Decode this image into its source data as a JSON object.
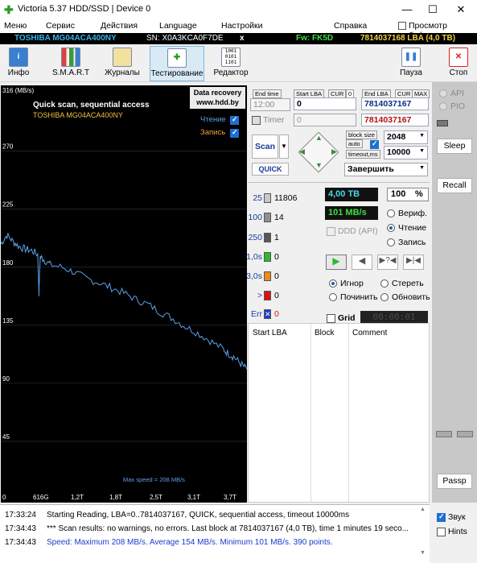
{
  "window": {
    "title": "Victoria 5.37 HDD/SSD | Device 0",
    "controls": [
      "—",
      "☐",
      "✕"
    ]
  },
  "menu": [
    "Меню",
    "Сервис",
    "Действия",
    "Language",
    "Настройки",
    "Справка"
  ],
  "menu_right": "Просмотр буфера",
  "drive": {
    "model": "TOSHIBA MG04ACA400NY",
    "serial": "SN: X0A3KCA0F7DE",
    "close": "x",
    "firmware": "Fw: FK5D",
    "lba": "7814037168 LBA (4,0 TB)"
  },
  "toolbar": [
    {
      "label": "Инфо"
    },
    {
      "label": "S.M.A.R.T"
    },
    {
      "label": "Журналы"
    },
    {
      "label": "Тестирование"
    },
    {
      "label": "Редактор"
    },
    {
      "label": "Пауза"
    },
    {
      "label": "Стоп"
    }
  ],
  "graph": {
    "ylabel": "316 (MB/s)",
    "title": "Quick scan, sequential access",
    "subtitle": "TOSHIBA MG04ACA400NY",
    "recovery_line1": "Data recovery",
    "recovery_line2": "www.hdd.by",
    "legend_read": "Чтение",
    "legend_write": "Запись",
    "max_speed": "Max speed = 208 MB/s",
    "yticks": [
      "270",
      "225",
      "180",
      "135",
      "90",
      "45"
    ],
    "xticks": [
      "0",
      "616G",
      "1,2T",
      "1,8T",
      "2,5T",
      "3,1T",
      "3,7T"
    ],
    "colors": {
      "read": "#5aa0e8",
      "title": "#ffffff",
      "subtitle": "#f0c040",
      "grid": "#2a3a4a"
    }
  },
  "chart_data": {
    "type": "line",
    "title": "Quick scan, sequential access",
    "ylabel": "316 (MB/s)",
    "xlabel": "",
    "ylim": [
      0,
      316
    ],
    "x_tick_labels": [
      "0",
      "616G",
      "1,2T",
      "1,8T",
      "2,5T",
      "3,1T",
      "3,7T"
    ],
    "y_tick_labels": [
      "45",
      "90",
      "135",
      "180",
      "225",
      "270"
    ],
    "series": [
      {
        "name": "Чтение",
        "x": [
          0,
          0.1,
          0.2,
          0.3,
          0.4,
          0.5,
          0.6,
          0.62,
          0.64,
          0.7,
          0.8,
          1.0,
          1.2,
          1.4,
          1.6,
          1.8,
          2.0,
          2.2,
          2.4,
          2.6,
          2.8,
          3.0,
          3.2,
          3.4,
          3.6,
          3.7,
          3.8,
          3.9,
          4.0
        ],
        "values": [
          198,
          205,
          200,
          196,
          194,
          193,
          190,
          160,
          188,
          186,
          182,
          180,
          176,
          171,
          168,
          164,
          160,
          155,
          151,
          145,
          140,
          134,
          129,
          123,
          117,
          113,
          110,
          105,
          101
        ]
      }
    ]
  },
  "controls": {
    "end_time_label": "End time",
    "end_time_value": "12:00",
    "start_lba_label": "Start LBA",
    "cur": "CUR",
    "start_lba_cur": "0",
    "start_lba_value": "0",
    "end_lba_label": "End LBA",
    "end_cur": "CUR",
    "max": "MAX",
    "end_lba_value": "7814037167",
    "timer_label": "Timer",
    "timer_value": "0",
    "end_lba_current": "7814037167",
    "scan": "Scan",
    "quick": "QUICK",
    "block_size_label": "block size",
    "auto_label": "auto",
    "timeout_label": "timeout,ms",
    "block_size": "2048",
    "timeout": "10000",
    "action": "Завершить"
  },
  "stats": {
    "blocks": [
      {
        "lat": "25",
        "count": "11806",
        "color": "#c8c8c8"
      },
      {
        "lat": "100",
        "count": "14",
        "color": "#909090"
      },
      {
        "lat": "250",
        "count": "1",
        "color": "#585858"
      },
      {
        "lat": "1,0s",
        "count": "0",
        "color": "#2eb82e"
      },
      {
        "lat": "3,0s",
        "count": "0",
        "color": "#ee8a1a"
      },
      {
        "lat": ">",
        "count": "0",
        "color": "#e01010"
      },
      {
        "lat": "Err",
        "count": "0",
        "color": "#1a3cc8"
      }
    ],
    "size": "4,00 TB",
    "percent": "100",
    "percent_unit": "%",
    "speed": "101 MB/s",
    "ddd": "DDD (API)",
    "mode_verify": "Вериф.",
    "mode_read": "Чтение",
    "mode_write": "Запись",
    "opt_ignore": "Игнор",
    "opt_erase": "Стереть",
    "opt_repair": "Починить",
    "opt_refresh": "Обновить",
    "grid": "Grid",
    "timer": "00:00:01"
  },
  "table": {
    "headers": [
      "Start LBA",
      "Block",
      "Comment"
    ]
  },
  "side": {
    "api": "API",
    "pio": "PIO",
    "sleep": "Sleep",
    "recall": "Recall",
    "passp": "Passp"
  },
  "log": {
    "rows": [
      {
        "time": "17:33:24",
        "text": "Starting Reading, LBA=0..7814037167, QUICK, sequential access, timeout 10000ms",
        "color": "#000000"
      },
      {
        "time": "17:34:43",
        "text": "*** Scan results: no warnings, no errors. Last block at 7814037167 (4,0 TB), time 1 minutes 19 seco...",
        "color": "#000000"
      },
      {
        "time": "17:34:43",
        "text": "Speed: Maximum 208 MB/s. Average 154 MB/s. Minimum 101 MB/s. 390 points.",
        "color": "#1a3cc8"
      }
    ],
    "sound": "Звук",
    "hints": "Hints"
  }
}
